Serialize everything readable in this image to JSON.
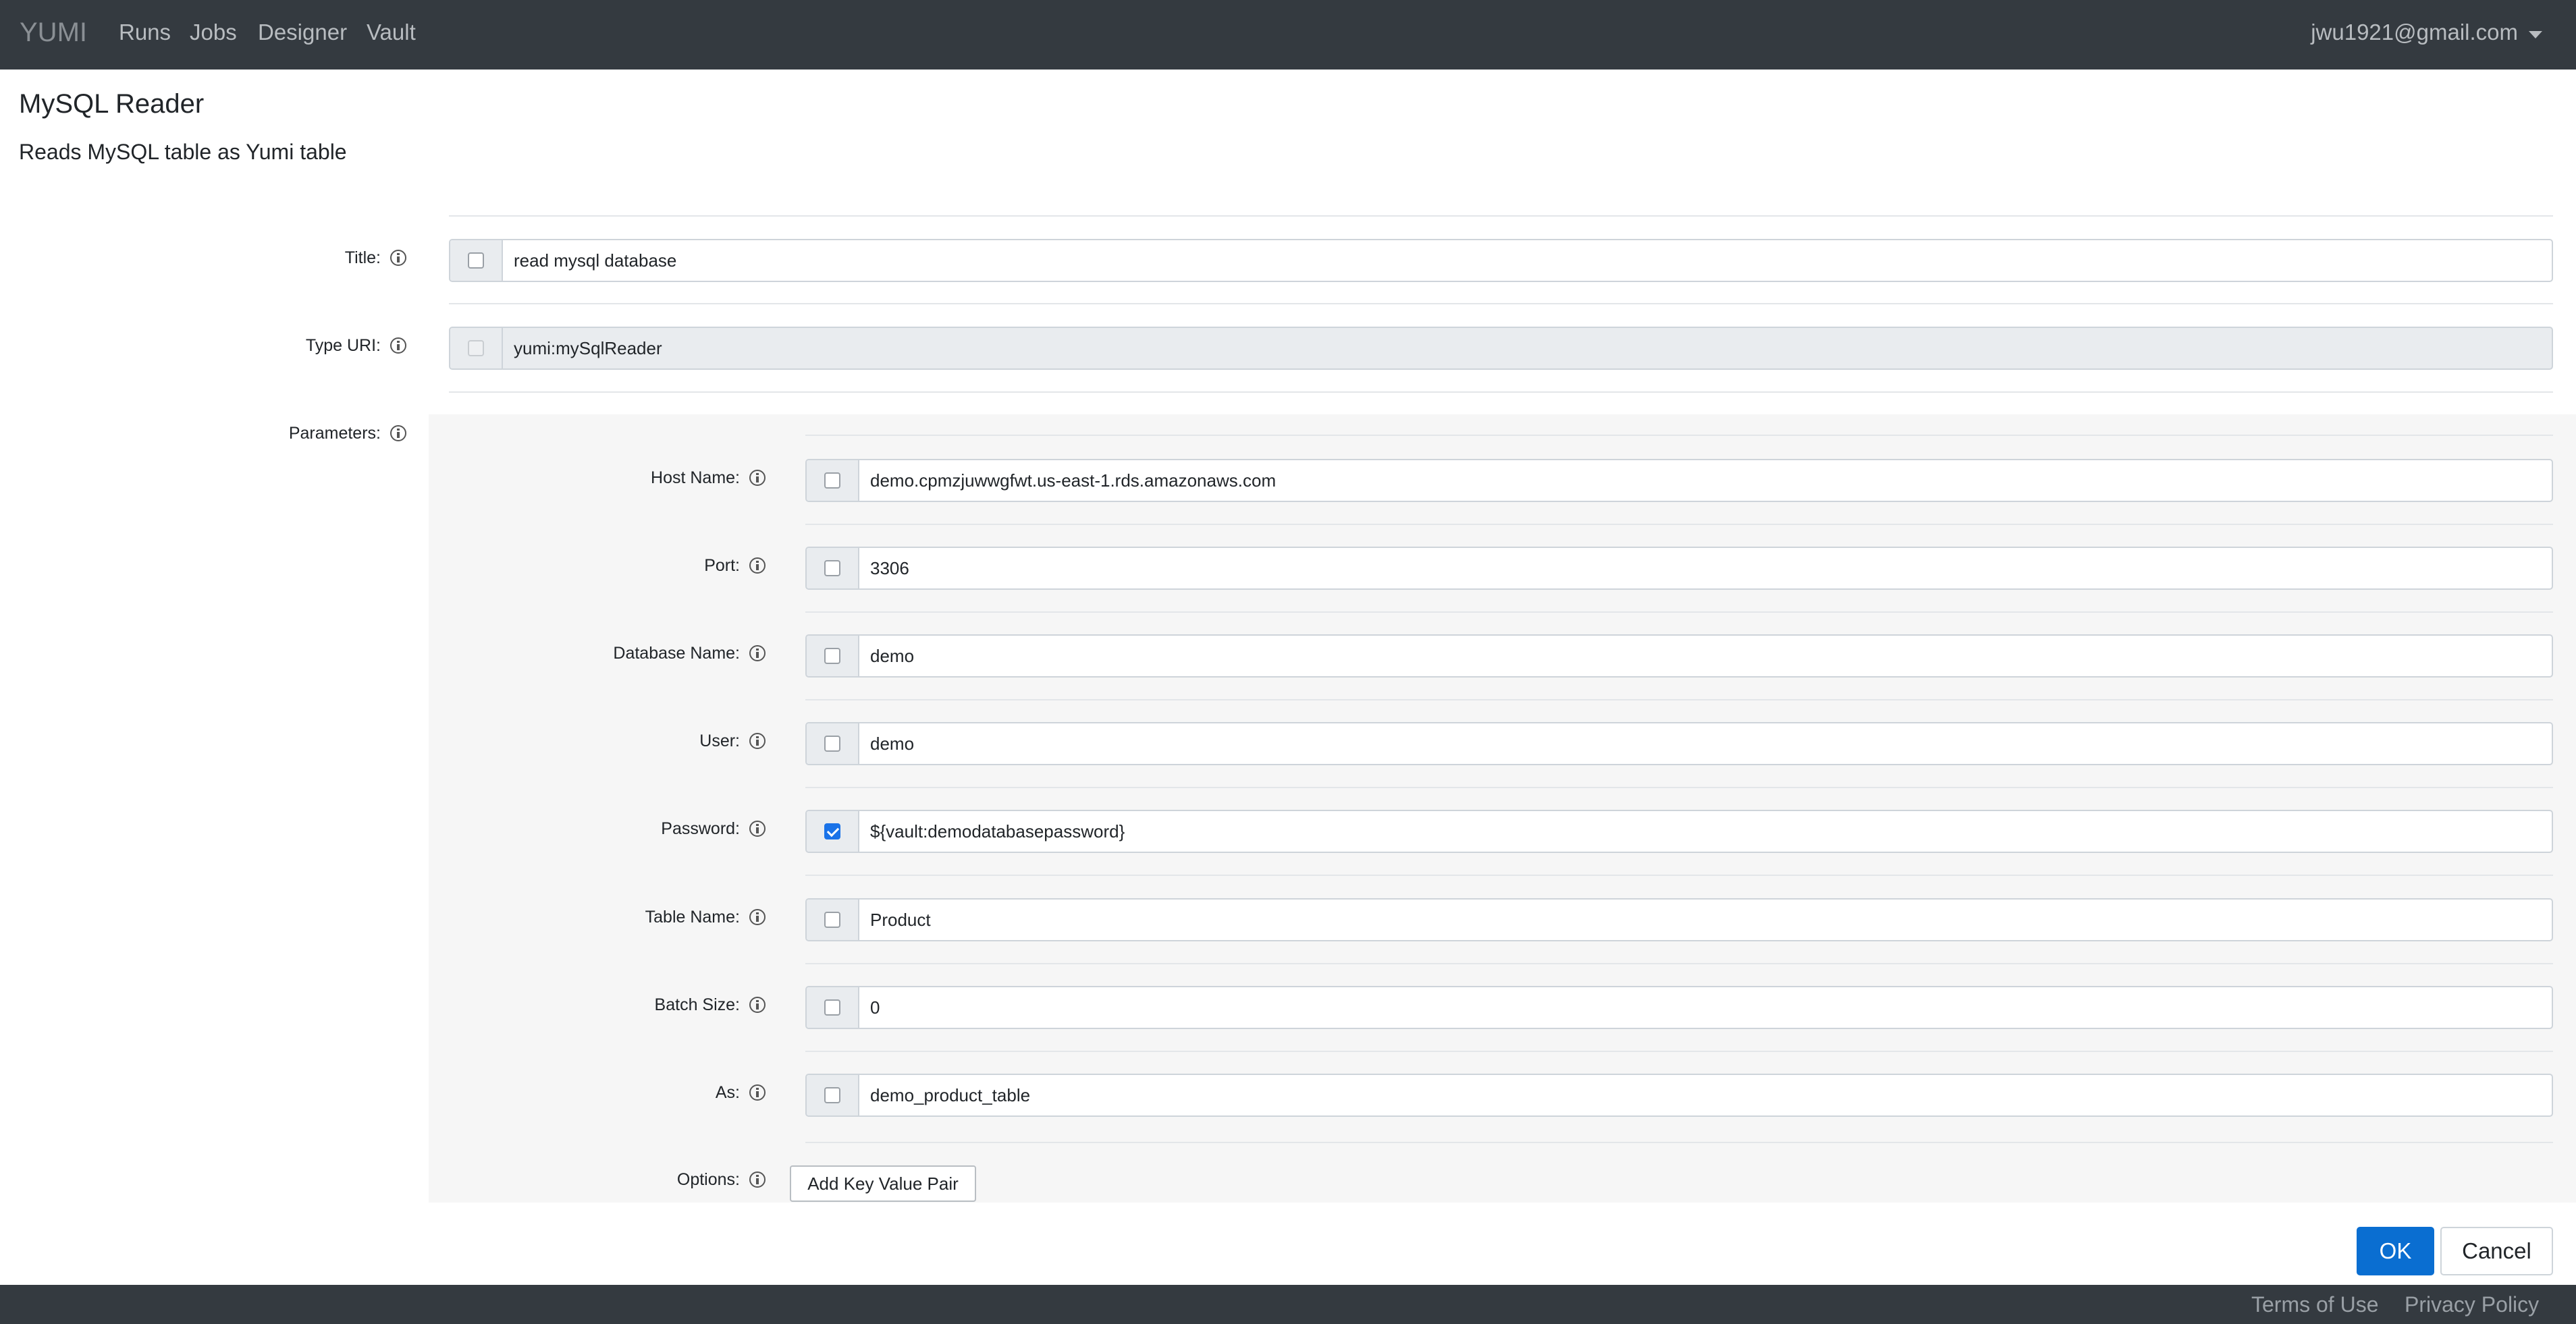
{
  "navbar": {
    "brand": "YUMI",
    "links": [
      "Runs",
      "Jobs",
      "Designer",
      "Vault"
    ],
    "user": "jwu1921@gmail.com"
  },
  "header": {
    "title": "MySQL Reader",
    "subtitle": "Reads MySQL table as Yumi table"
  },
  "form": {
    "title": {
      "label": "Title:",
      "value": "read mysql database",
      "checked": false
    },
    "type_uri": {
      "label": "Type URI:",
      "value": "yumi:mySqlReader",
      "checked": false
    },
    "parameters_label": "Parameters:"
  },
  "parameters": [
    {
      "label": "Host Name:",
      "value": "demo.cpmzjuwwgfwt.us-east-1.rds.amazonaws.com",
      "checked": false
    },
    {
      "label": "Port:",
      "value": "3306",
      "checked": false
    },
    {
      "label": "Database Name:",
      "value": "demo",
      "checked": false
    },
    {
      "label": "User:",
      "value": "demo",
      "checked": false
    },
    {
      "label": "Password:",
      "value": "${vault:demodatabasepassword}",
      "checked": true
    },
    {
      "label": "Table Name:",
      "value": "Product",
      "checked": false
    },
    {
      "label": "Batch Size:",
      "value": "0",
      "checked": false
    },
    {
      "label": "As:",
      "value": "demo_product_table",
      "checked": false
    }
  ],
  "options": {
    "label": "Options:",
    "add_button": "Add Key Value Pair"
  },
  "actions": {
    "ok": "OK",
    "cancel": "Cancel"
  },
  "footer": {
    "terms": "Terms of Use",
    "privacy": "Privacy Policy"
  },
  "colors": {
    "navbar": "#343a40",
    "primary": "#0a6ed1",
    "checkbox_checked": "#1a73e8"
  }
}
